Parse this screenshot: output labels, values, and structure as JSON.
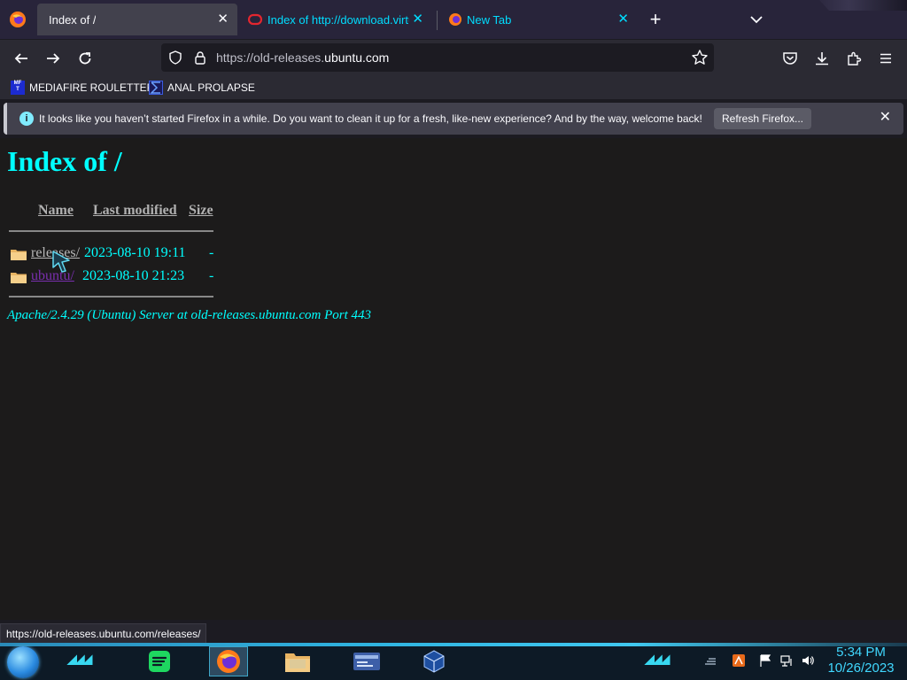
{
  "browser": {
    "tabs": [
      {
        "title": "Index of /",
        "active": true,
        "favicon": "firefox-icon"
      },
      {
        "title": "Index of http://download.virtua",
        "active": false,
        "favicon": "oracle-icon"
      },
      {
        "title": "New Tab",
        "active": false,
        "favicon": "firefox-icon"
      }
    ],
    "newtab_label": "+",
    "close_glyph": "✕",
    "url": {
      "scheme_prefix": "https://old-releases.",
      "host": "ubuntu.com"
    },
    "bookmarks": [
      {
        "label": "MEDIAFIRE ROULETTER",
        "icon": "mediafire-icon",
        "icon_text": "MF\nT"
      },
      {
        "label": "ANAL PROLAPSE",
        "icon": "sigma-icon"
      }
    ],
    "notification": {
      "info_glyph": "i",
      "text": "It looks like you haven’t started Firefox in a while. Do you want to clean it up for a fresh, like-new experience? And by the way, welcome back!",
      "button": "Refresh Firefox...",
      "close_glyph": "✕"
    },
    "status_link": "https://old-releases.ubuntu.com/releases/"
  },
  "page": {
    "heading": "Index of /",
    "columns": {
      "name": "Name",
      "last_modified": "Last modified",
      "size": "Size"
    },
    "rows": [
      {
        "name": "releases/",
        "modified": "2023-08-10 19:11",
        "size": "-",
        "visited": false
      },
      {
        "name": "ubuntu/",
        "modified": "2023-08-10 21:23",
        "size": "-",
        "visited": true
      }
    ],
    "address": "Apache/2.4.29 (Ubuntu) Server at old-releases.ubuntu.com Port 443"
  },
  "taskbar": {
    "apps": [
      "start-orb-icon",
      "spotify-icon",
      "firefox-icon",
      "file-explorer-icon",
      "app-window-icon",
      "virtualbox-icon"
    ],
    "clock": {
      "time": "5:34 PM",
      "date": "10/26/2023"
    }
  },
  "colors": {
    "page_bg": "#1c1b1b",
    "link_text": "#00ffff",
    "visited_link": "#7b2fb0",
    "accent_tab": "#00ddff"
  }
}
